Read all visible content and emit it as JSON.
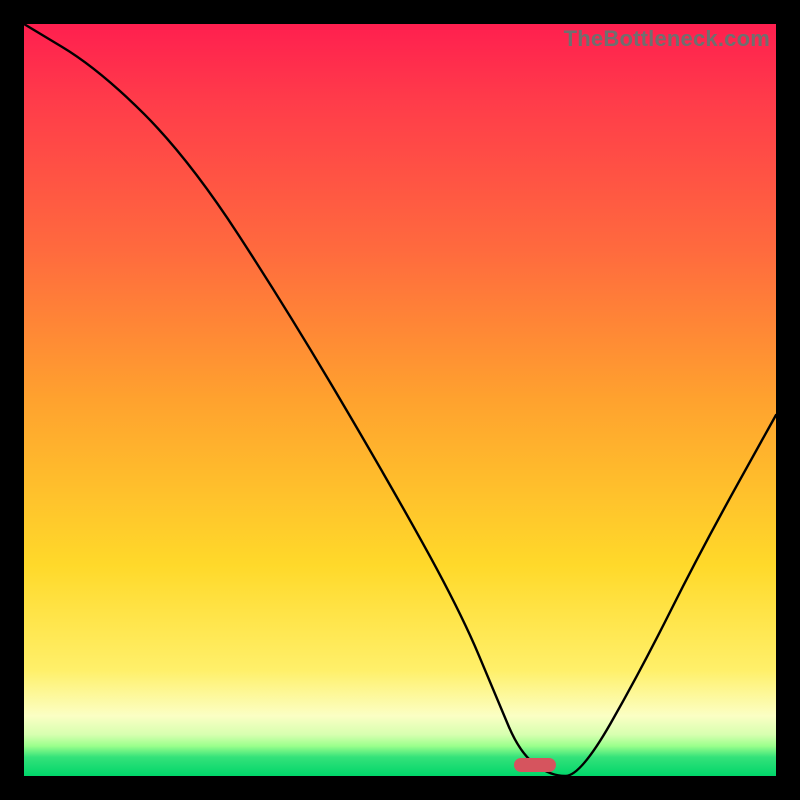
{
  "watermark": "TheBottleneck.com",
  "chart_data": {
    "type": "line",
    "title": "",
    "xlabel": "",
    "ylabel": "",
    "xlim": [
      0,
      100
    ],
    "ylim": [
      0,
      100
    ],
    "series": [
      {
        "name": "bottleneck-curve",
        "x": [
          0,
          10,
          22,
          35,
          48,
          58,
          63,
          66,
          70,
          74,
          82,
          90,
          100
        ],
        "values": [
          100,
          94,
          82,
          62,
          40,
          22,
          10,
          3,
          0,
          0,
          14,
          30,
          48
        ]
      }
    ],
    "marker": {
      "x": 68,
      "y": 0,
      "width_pct": 5.6,
      "height_pct": 1.9
    },
    "colors": {
      "gradient_top": "#ff1f4f",
      "gradient_mid": "#ffd92a",
      "gradient_bottom": "#00d66a",
      "curve": "#000000",
      "marker": "#d6545e",
      "frame": "#000000"
    }
  }
}
